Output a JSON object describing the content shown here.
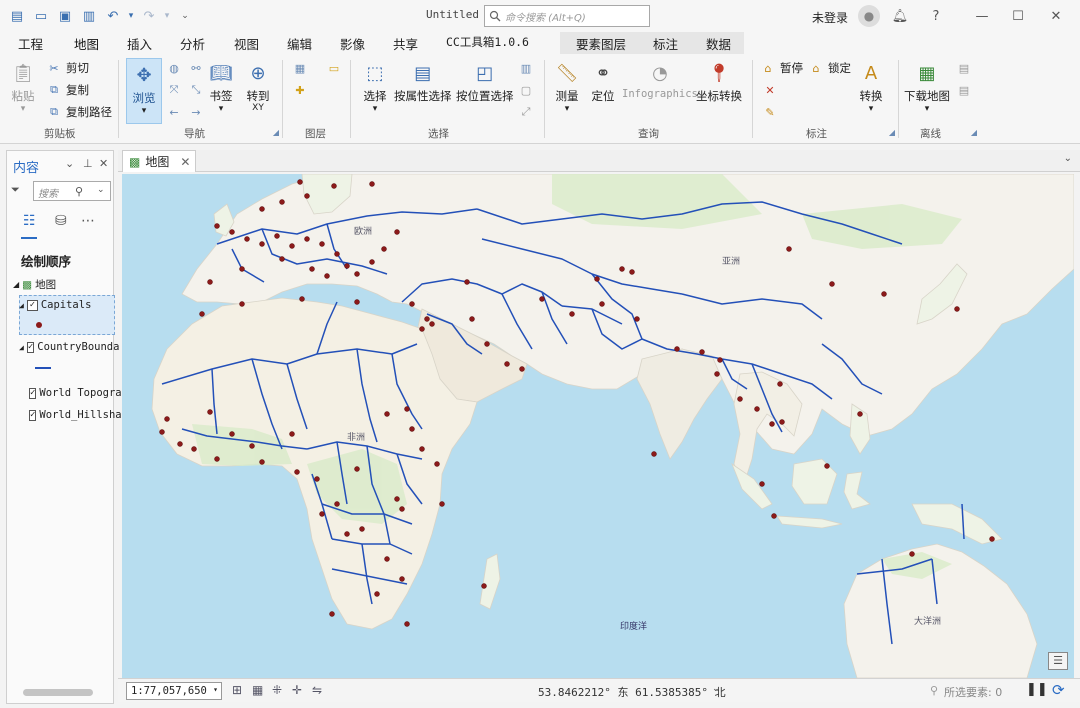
{
  "window": {
    "title": "Untitled",
    "search_placeholder": "命令搜索 (Alt+Q)",
    "signin": "未登录",
    "help": "?"
  },
  "menu_tabs": [
    "工程",
    "地图",
    "插入",
    "分析",
    "视图",
    "编辑",
    "影像",
    "共享",
    "CC工具箱1.0.6",
    "要素图层",
    "标注",
    "数据"
  ],
  "ribbon": {
    "clipboard": {
      "paste": "粘贴",
      "cut": "剪切",
      "copy": "复制",
      "copy_path": "复制路径",
      "group": "剪贴板"
    },
    "navigate": {
      "browse": "浏览",
      "bookmark": "书签",
      "goto": "转到",
      "goto_sub": "XY",
      "group": "导航"
    },
    "layer": {
      "group": "图层"
    },
    "selection": {
      "select": "选择",
      "by_attr": "按属性选择",
      "by_loc": "按位置选择",
      "group": "选择"
    },
    "inquiry": {
      "measure": "测量",
      "locate": "定位",
      "infographics": "Infographics",
      "convert_coord": "坐标转换",
      "group": "查询"
    },
    "labeling": {
      "pause": "暂停",
      "lock": "锁定",
      "convert": "转换",
      "group": "标注"
    },
    "offline": {
      "download": "下载地图",
      "group": "离线"
    }
  },
  "contents": {
    "title": "内容",
    "search_placeholder": "搜索",
    "draw_order": "绘制顺序",
    "map_node": "地图",
    "layers": [
      "Capitals",
      "CountryBoundaries",
      "World Topographic Map",
      "World_Hillshade"
    ]
  },
  "map": {
    "tab": "地图",
    "labels": {
      "europe": "欧洲",
      "asia": "亚洲",
      "africa": "非洲",
      "indian_ocean": "印度洋",
      "oceania": "大洋洲"
    }
  },
  "status": {
    "scale": "1:77,057,650",
    "coords": "53.8462212° 东 61.5385385° 北",
    "selected": "所选要素: 0"
  },
  "colors": {
    "accent": "#2b6cc4",
    "boundary": "#2350b8",
    "capital": "#8b1a1a",
    "sea": "#b7ddef",
    "land": "#f4f2ec"
  }
}
